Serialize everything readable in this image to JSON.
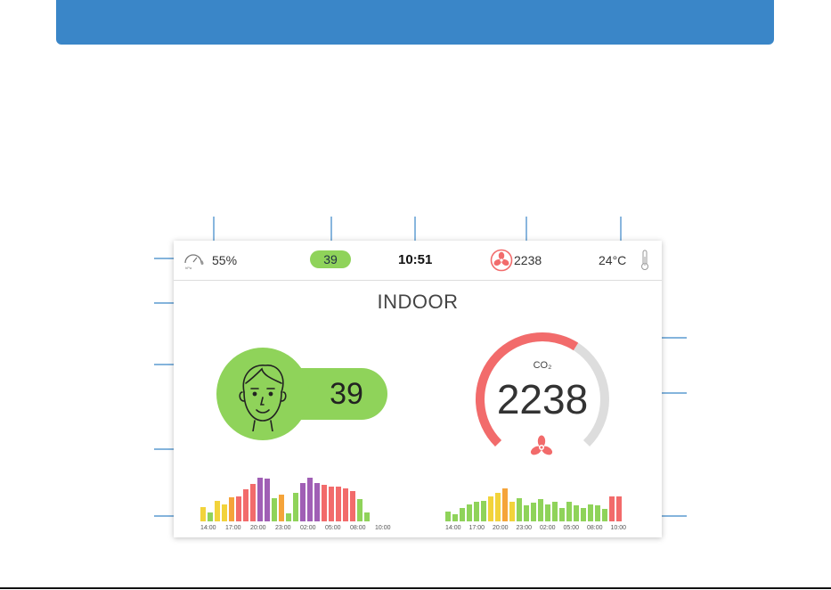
{
  "status_bar": {
    "humidity": "55%",
    "gauge_caption": "hPa",
    "index_pill": "39",
    "time": "10:51",
    "co2": "2238",
    "temperature": "24°C"
  },
  "indoor_title": "INDOOR",
  "comfort": {
    "index": "39"
  },
  "co2_gauge": {
    "label": "CO₂",
    "value": "2238",
    "level_fraction": 0.62
  },
  "colors": {
    "banner": "#3a86c8",
    "good": "#8fd35a",
    "alert": "#f26b6b",
    "gauge_track": "#dddddd",
    "callout_line": "#3a86c8"
  },
  "history_left": {
    "ticks": [
      "14:00",
      "17:00",
      "20:00",
      "23:00",
      "02:00",
      "05:00",
      "08:00",
      "10:00"
    ],
    "bars": [
      {
        "level": 0.28,
        "color": "#f2d33b"
      },
      {
        "level": 0.18,
        "color": "#8fd35a"
      },
      {
        "level": 0.4,
        "color": "#f2d33b"
      },
      {
        "level": 0.33,
        "color": "#f2d33b"
      },
      {
        "level": 0.47,
        "color": "#f5a43a"
      },
      {
        "level": 0.49,
        "color": "#f26b6b"
      },
      {
        "level": 0.63,
        "color": "#f26b6b"
      },
      {
        "level": 0.73,
        "color": "#f26b6b"
      },
      {
        "level": 0.86,
        "color": "#a05fb5"
      },
      {
        "level": 0.84,
        "color": "#a05fb5"
      },
      {
        "level": 0.46,
        "color": "#8fd35a"
      },
      {
        "level": 0.52,
        "color": "#f5a43a"
      },
      {
        "level": 0.16,
        "color": "#8fd35a"
      },
      {
        "level": 0.56,
        "color": "#8fd35a"
      },
      {
        "level": 0.75,
        "color": "#a05fb5"
      },
      {
        "level": 0.86,
        "color": "#a05fb5"
      },
      {
        "level": 0.75,
        "color": "#a05fb5"
      },
      {
        "level": 0.72,
        "color": "#f26b6b"
      },
      {
        "level": 0.68,
        "color": "#f26b6b"
      },
      {
        "level": 0.68,
        "color": "#f26b6b"
      },
      {
        "level": 0.65,
        "color": "#f26b6b"
      },
      {
        "level": 0.6,
        "color": "#f26b6b"
      },
      {
        "level": 0.44,
        "color": "#8fd35a"
      },
      {
        "level": 0.18,
        "color": "#8fd35a"
      }
    ]
  },
  "history_right": {
    "ticks": [
      "14:00",
      "17:00",
      "20:00",
      "23:00",
      "02:00",
      "05:00",
      "08:00",
      "10:00"
    ],
    "bars": [
      {
        "level": 0.22,
        "color": "#8fd35a"
      },
      {
        "level": 0.16,
        "color": "#8fd35a"
      },
      {
        "level": 0.3,
        "color": "#8fd35a"
      },
      {
        "level": 0.38,
        "color": "#8fd35a"
      },
      {
        "level": 0.44,
        "color": "#8fd35a"
      },
      {
        "level": 0.47,
        "color": "#8fd35a"
      },
      {
        "level": 0.58,
        "color": "#f2d33b"
      },
      {
        "level": 0.66,
        "color": "#f2d33b"
      },
      {
        "level": 0.76,
        "color": "#f5a43a"
      },
      {
        "level": 0.45,
        "color": "#f2d33b"
      },
      {
        "level": 0.54,
        "color": "#8fd35a"
      },
      {
        "level": 0.36,
        "color": "#8fd35a"
      },
      {
        "level": 0.43,
        "color": "#8fd35a"
      },
      {
        "level": 0.51,
        "color": "#8fd35a"
      },
      {
        "level": 0.38,
        "color": "#8fd35a"
      },
      {
        "level": 0.45,
        "color": "#8fd35a"
      },
      {
        "level": 0.31,
        "color": "#8fd35a"
      },
      {
        "level": 0.44,
        "color": "#8fd35a"
      },
      {
        "level": 0.37,
        "color": "#8fd35a"
      },
      {
        "level": 0.3,
        "color": "#8fd35a"
      },
      {
        "level": 0.38,
        "color": "#8fd35a"
      },
      {
        "level": 0.36,
        "color": "#8fd35a"
      },
      {
        "level": 0.29,
        "color": "#8fd35a"
      },
      {
        "level": 0.58,
        "color": "#f26b6b"
      },
      {
        "level": 0.58,
        "color": "#f26b6b"
      }
    ]
  }
}
